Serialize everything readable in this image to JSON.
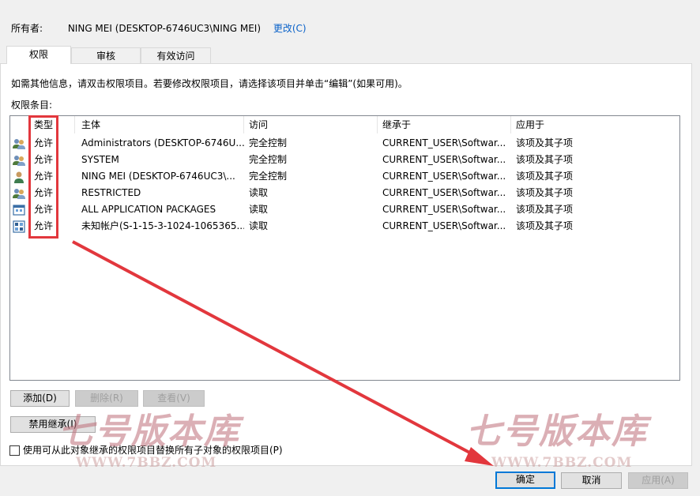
{
  "owner": {
    "label": "所有者:",
    "value": "NING MEI (DESKTOP-6746UC3\\NING MEI)",
    "change_link": "更改(C)"
  },
  "tabs": [
    {
      "label": "权限",
      "active": true
    },
    {
      "label": "审核",
      "active": false
    },
    {
      "label": "有效访问",
      "active": false
    }
  ],
  "info_text": "如需其他信息，请双击权限项目。若要修改权限项目，请选择该项目并单击“编辑”(如果可用)。",
  "entries_label": "权限条目:",
  "columns": [
    "类型",
    "主体",
    "访问",
    "继承于",
    "应用于"
  ],
  "rows": [
    {
      "icon": "group-user-icon",
      "type": "允许",
      "principal": "Administrators (DESKTOP-6746U...",
      "access": "完全控制",
      "inherited": "CURRENT_USER\\Softwar...",
      "applies": "该项及其子项"
    },
    {
      "icon": "group-user-icon",
      "type": "允许",
      "principal": "SYSTEM",
      "access": "完全控制",
      "inherited": "CURRENT_USER\\Softwar...",
      "applies": "该项及其子项"
    },
    {
      "icon": "single-user-icon",
      "type": "允许",
      "principal": "NING MEI (DESKTOP-6746UC3\\...",
      "access": "完全控制",
      "inherited": "CURRENT_USER\\Softwar...",
      "applies": "该项及其子项"
    },
    {
      "icon": "group-user-icon",
      "type": "允许",
      "principal": "RESTRICTED",
      "access": "读取",
      "inherited": "CURRENT_USER\\Softwar...",
      "applies": "该项及其子项"
    },
    {
      "icon": "app-package-icon",
      "type": "允许",
      "principal": "ALL APPLICATION PACKAGES",
      "access": "读取",
      "inherited": "CURRENT_USER\\Softwar...",
      "applies": "该项及其子项"
    },
    {
      "icon": "unknown-account-icon",
      "type": "允许",
      "principal": "未知帐户(S-1-15-3-1024-1065365...",
      "access": "读取",
      "inherited": "CURRENT_USER\\Softwar...",
      "applies": "该项及其子项"
    }
  ],
  "buttons": {
    "add": "添加(D)",
    "remove": "删除(R)",
    "view": "查看(V)",
    "disable_inheritance": "禁用继承(I)",
    "ok": "确定",
    "cancel": "取消",
    "apply": "应用(A)"
  },
  "replace_checkbox": {
    "label": "使用可从此对象继承的权限项目替换所有子对象的权限项目(P)",
    "checked": false
  },
  "watermark": {
    "title": "七号版本库",
    "url": "WWW.7BBZ.COM"
  },
  "colors": {
    "annotation_red": "#e2373d",
    "link_blue": "#0a62c9",
    "default_button_border": "#0078d7"
  }
}
